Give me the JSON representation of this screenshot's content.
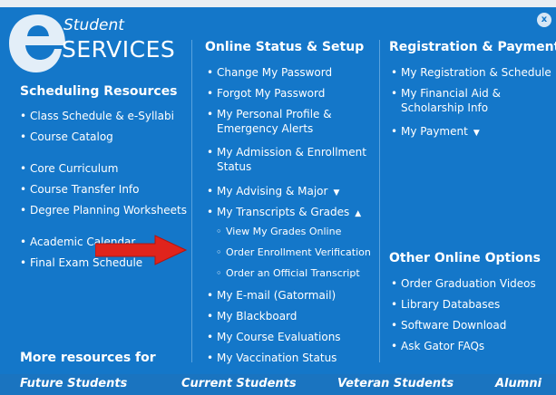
{
  "logo": {
    "student": "Student",
    "services": "SERVICES"
  },
  "close": {
    "glyph": "x"
  },
  "scheduling": {
    "title": "Scheduling Resources",
    "items": [
      "Class Schedule & e-Syllabi",
      "Course Catalog",
      "Core Curriculum",
      "Course Transfer Info",
      "Degree Planning Worksheets",
      "Academic Calendar",
      "Final Exam Schedule"
    ]
  },
  "online": {
    "title": "Online Status & Setup",
    "items": [
      "Change My Password",
      "Forgot My Password",
      "My Personal Profile &",
      "Emergency Alerts",
      "My Admission & Enrollment",
      "Status",
      "My Advising & Major",
      "My Transcripts & Grades",
      "My E-mail (Gatormail)",
      "My Blackboard",
      "My Course Evaluations",
      "My Vaccination Status"
    ],
    "subitems": [
      "View My Grades Online",
      "Order Enrollment Verification",
      "Order an Official Transcript"
    ]
  },
  "registration": {
    "title": "Registration & Payment",
    "items": [
      "My Registration & Schedule",
      "My Financial Aid &",
      "Scholarship Info",
      "My Payment"
    ]
  },
  "other": {
    "title": "Other Online Options",
    "items": [
      "Order Graduation Videos",
      "Library Databases",
      "Software Download",
      "Ask Gator FAQs"
    ]
  },
  "more": {
    "title": "More resources for"
  },
  "bottom": [
    "Future Students",
    "Current Students",
    "Veteran Students",
    "Alumni"
  ],
  "colors": {
    "background": "#1477c9",
    "arrow": "#e0241c"
  }
}
